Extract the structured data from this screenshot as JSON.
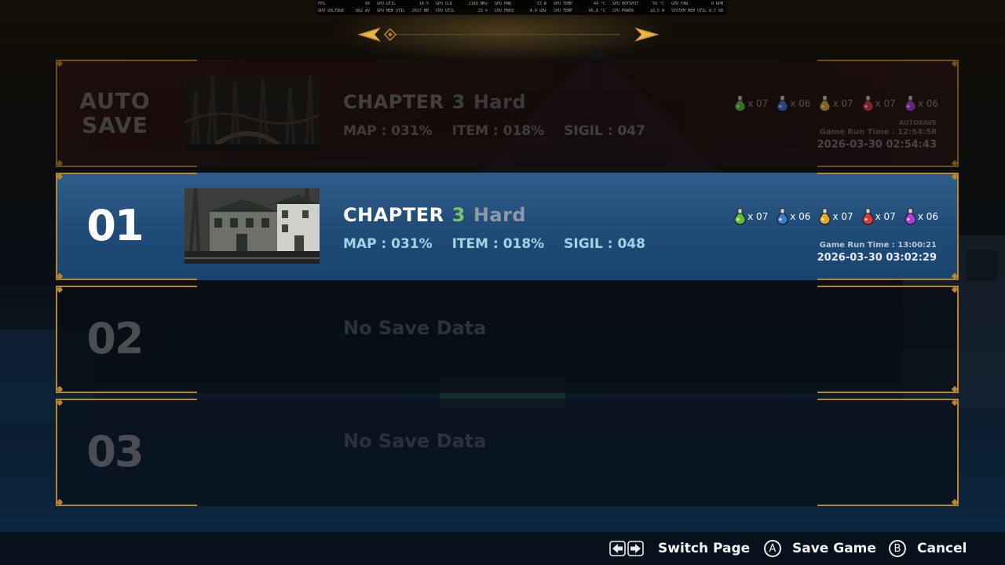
{
  "overlay": {
    "rows": [
      [
        {
          "label": "FPS",
          "value": "60"
        },
        {
          "label": "GPU UTIL",
          "value": "16 %"
        },
        {
          "label": "GPU CLK",
          "value": "2168 MHz"
        },
        {
          "label": "GPU PWR",
          "value": "57 W"
        },
        {
          "label": "GPU TEMP",
          "value": "44 °C"
        },
        {
          "label": "GPU HOTSPOT",
          "value": "50 °C"
        },
        {
          "label": "GPU FAN",
          "value": "0 RPM"
        }
      ],
      [
        {
          "label": "GPU VOLTAGE",
          "value": "862 mV"
        },
        {
          "label": "GPU MEM UTIL",
          "value": "2027 MB"
        },
        {
          "label": "CPU UTIL",
          "value": "23 %"
        },
        {
          "label": "CPU FREQ",
          "value": "4.0 GHz"
        },
        {
          "label": "CPU TEMP",
          "value": "45.8 °C"
        },
        {
          "label": "CPU POWER",
          "value": "18.5 W"
        },
        {
          "label": "SYSTEM MEM UTIL",
          "value": "8.7 GB"
        }
      ]
    ]
  },
  "colors": {
    "gold": "#b8862a",
    "selected_bg": "#214c78",
    "chapter_num": "#7cc26a",
    "difficulty": "#8e98a6",
    "stat_label": "#9fd6e6"
  },
  "icons": {
    "page_prev": "arrow-left-icon",
    "page_next": "arrow-right-icon",
    "potion": "potion-icon"
  },
  "slots": {
    "auto": {
      "label_line1": "AUTO",
      "label_line2": "SAVE",
      "chapter_label": "CHAPTER",
      "chapter_num": "3",
      "difficulty": "Hard",
      "map": "MAP : 031%",
      "item": "ITEM : 018%",
      "sigil": "SIGIL : 047",
      "items": [
        {
          "color": "#5fbf3a",
          "count": "x 07"
        },
        {
          "color": "#3b78d8",
          "count": "x 06"
        },
        {
          "color": "#e0a82a",
          "count": "x 07"
        },
        {
          "color": "#d83a3a",
          "count": "x 07"
        },
        {
          "color": "#b03ad8",
          "count": "x 06"
        }
      ],
      "tag": "AUTOSAVE",
      "run_time": "Game Run Time : 12:54:58",
      "timestamp": "2026-03-30 02:54:43"
    },
    "s01": {
      "number": "01",
      "chapter_label": "CHAPTER",
      "chapter_num": "3",
      "difficulty": "Hard",
      "map": "MAP : 031%",
      "item": "ITEM : 018%",
      "sigil": "SIGIL : 048",
      "items": [
        {
          "color": "#5fbf3a",
          "count": "x 07"
        },
        {
          "color": "#3b78d8",
          "count": "x 06"
        },
        {
          "color": "#e0a82a",
          "count": "x 07"
        },
        {
          "color": "#d83a3a",
          "count": "x 07"
        },
        {
          "color": "#b03ad8",
          "count": "x 06"
        }
      ],
      "run_time": "Game Run Time : 13:00:21",
      "timestamp": "2026-03-30 03:02:29"
    },
    "s02": {
      "number": "02",
      "empty": "No Save Data"
    },
    "s03": {
      "number": "03",
      "empty": "No Save Data"
    }
  },
  "hints": {
    "switch_page": "Switch Page",
    "save_btn_glyph": "A",
    "save": "Save Game",
    "cancel_btn_glyph": "B",
    "cancel": "Cancel"
  }
}
